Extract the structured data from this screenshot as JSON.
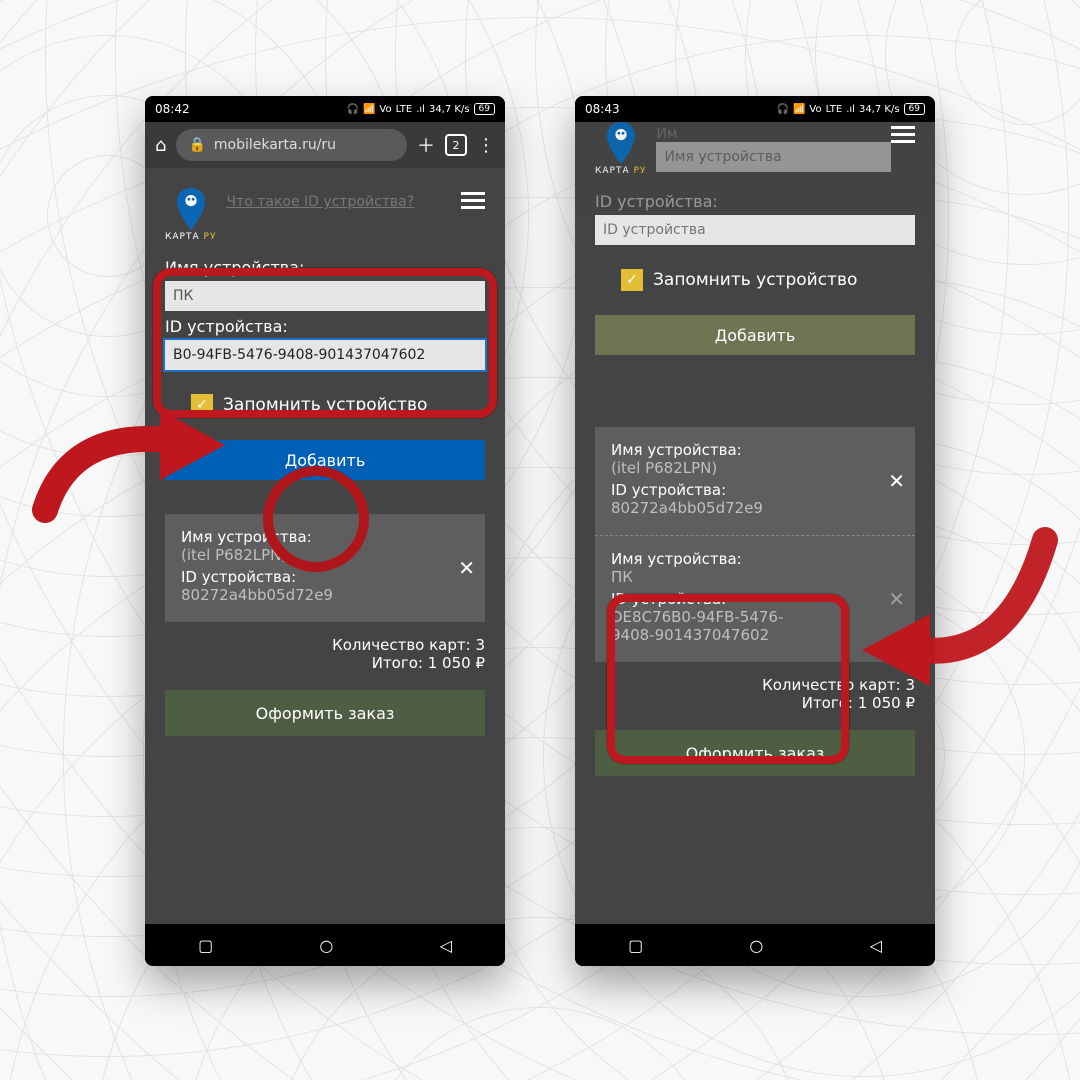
{
  "status": {
    "time1": "08:42",
    "time2": "08:43",
    "net": "LTE",
    "vo": "Vo",
    "signal": "⁴⁶",
    "speed": "34,7 K/s",
    "batt": "69"
  },
  "chrome": {
    "url": "mobilekarta.ru/ru",
    "tab_count": "2"
  },
  "logo": {
    "line1": "КАРТА",
    "line2": "РУ"
  },
  "hint_link": "Что такое ID устройства?",
  "form": {
    "name_label": "Имя устройства:",
    "name_value_left": "ПК",
    "name_placeholder_right": "Имя устройства",
    "id_label": "ID устройства:",
    "id_value_left": "B0-94FB-5476-9408-901437047602",
    "id_placeholder_right": "ID устройства",
    "remember": "Запомнить устройство",
    "add": "Добавить"
  },
  "devices": {
    "d1": {
      "name_label": "Имя устройства:",
      "name": "(itel P682LPN)",
      "id_label": "ID устройства:",
      "id": "80272a4bb05d72e9"
    },
    "d2": {
      "name_label": "Имя устройства:",
      "name": "ПК",
      "id_label": "ID устройства:",
      "id": "DE8C76B0-94FB-5476-9408-901437047602"
    }
  },
  "summary": {
    "count": "Количество карт: 3",
    "total": "Итого: 1 050 ₽"
  },
  "order": "Оформить заказ"
}
